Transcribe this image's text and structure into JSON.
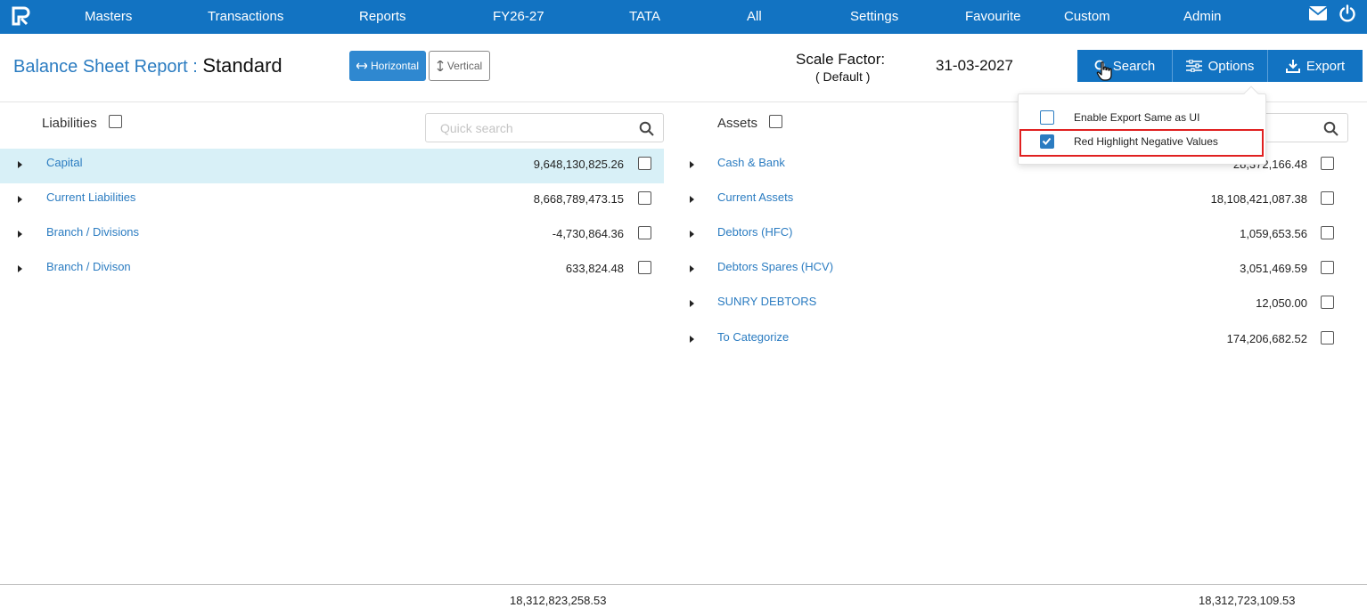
{
  "nav": {
    "items": [
      "Masters",
      "Transactions",
      "Reports",
      "FY26-27",
      "TATA",
      "All",
      "Settings",
      "Favourite",
      "Custom",
      "Admin"
    ],
    "icons": [
      "mail-icon",
      "power-icon"
    ]
  },
  "header": {
    "title_prefix": "Balance Sheet Report :",
    "title_name": "Standard",
    "view_horizontal": "Horizontal",
    "view_vertical": "Vertical",
    "scale_label": "Scale Factor:",
    "scale_value": "( Default )",
    "date": "31-03-2027",
    "search_label": "Search",
    "options_label": "Options",
    "export_label": "Export",
    "accent_color": "#1273c2"
  },
  "options_menu": {
    "items": [
      {
        "label": "Enable Export Same as UI",
        "checked": false
      },
      {
        "label": "Red Highlight Negative Values",
        "checked": true
      }
    ]
  },
  "liabilities": {
    "label": "Liabilities",
    "search_placeholder": "Quick search",
    "rows": [
      {
        "name": "Capital",
        "amount": "9,648,130,825.26"
      },
      {
        "name": "Current Liabilities",
        "amount": "8,668,789,473.15"
      },
      {
        "name": "Branch / Divisions",
        "amount": "-4,730,864.36"
      },
      {
        "name": "Branch / Divison",
        "amount": "633,824.48"
      }
    ],
    "total": "18,312,823,258.53"
  },
  "assets": {
    "label": "Assets",
    "rows": [
      {
        "name": "Cash & Bank",
        "amount": "28,372,166.48"
      },
      {
        "name": "Current Assets",
        "amount": "18,108,421,087.38"
      },
      {
        "name": "Debtors (HFC)",
        "amount": "1,059,653.56"
      },
      {
        "name": "Debtors Spares (HCV)",
        "amount": "3,051,469.59"
      },
      {
        "name": "SUNRY DEBTORS",
        "amount": "12,050.00"
      },
      {
        "name": "To Categorize",
        "amount": "174,206,682.52"
      }
    ],
    "total": "18,312,723,109.53"
  }
}
